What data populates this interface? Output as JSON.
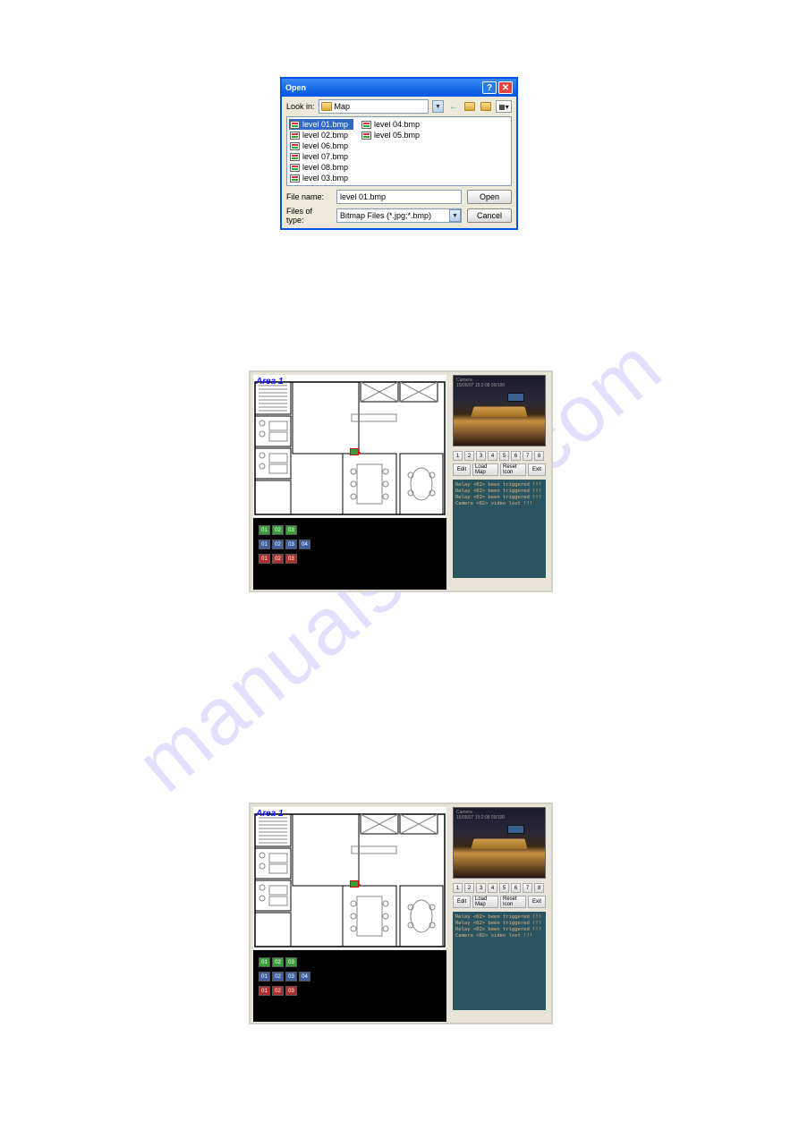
{
  "watermark": "manualshive.com",
  "open_dialog": {
    "title": "Open",
    "lookin_label": "Look in:",
    "lookin_value": "Map",
    "files": [
      {
        "name": "level 01.bmp",
        "selected": true
      },
      {
        "name": "level 02.bmp",
        "selected": false
      },
      {
        "name": "level 06.bmp",
        "selected": false
      },
      {
        "name": "level 07.bmp",
        "selected": false
      },
      {
        "name": "level 08.bmp",
        "selected": false
      },
      {
        "name": "level 03.bmp",
        "selected": false
      },
      {
        "name": "level 04.bmp",
        "selected": false
      },
      {
        "name": "level 05.bmp",
        "selected": false
      }
    ],
    "filename_label": "File name:",
    "filename_value": "level 01.bmp",
    "filetype_label": "Files of type:",
    "filetype_value": "Bitmap Files (*.jpg;*.bmp)",
    "open_btn": "Open",
    "cancel_btn": "Cancel"
  },
  "emap": {
    "area_label": "Area 1",
    "preview_overlay_line1": "Camera",
    "preview_overlay_line2": "15/05/07 15:2:08 09/100",
    "nums": [
      "1",
      "2",
      "3",
      "4",
      "5",
      "6",
      "7",
      "8"
    ],
    "btn_edit": "Edit",
    "btn_loadmap": "Load Map",
    "btn_reseticon": "Reset Icon",
    "btn_exit": "Exit",
    "log_lines": [
      "Relay <02> been triggered !!!",
      "Relay <02> been triggered !!!",
      "Relay <02> been triggered !!!",
      "Camera <02> video lost !!!"
    ],
    "tray_row1": [
      "01",
      "02",
      "03"
    ],
    "tray_row2": [
      "01",
      "02",
      "03",
      "04"
    ],
    "tray_row3": [
      "01",
      "02",
      "03"
    ]
  }
}
